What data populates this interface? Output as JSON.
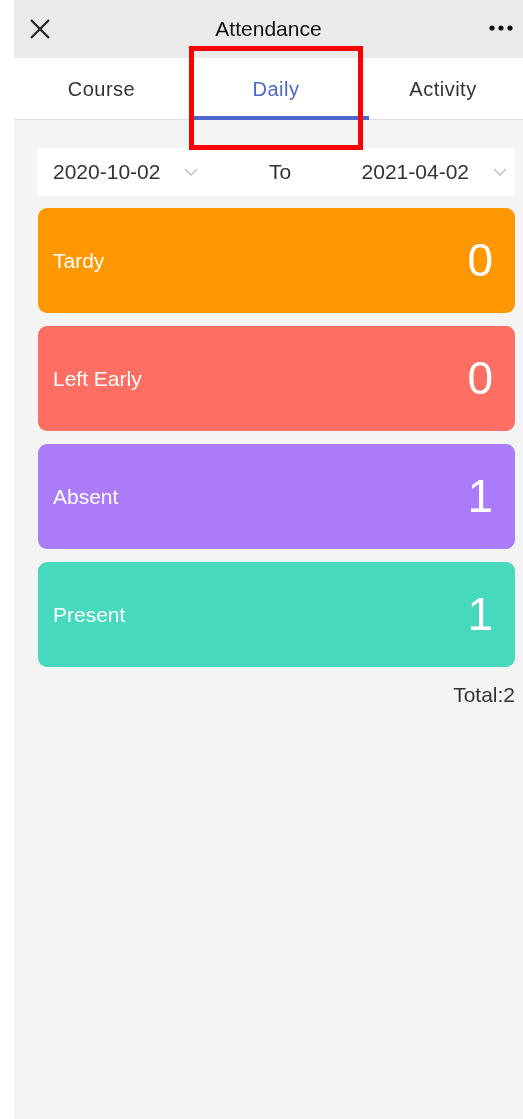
{
  "header": {
    "title": "Attendance"
  },
  "tabs": [
    {
      "label": "Course",
      "selected": false,
      "highlighted": false
    },
    {
      "label": "Daily",
      "selected": true,
      "highlighted": true
    },
    {
      "label": "Activity",
      "selected": false,
      "highlighted": false
    }
  ],
  "date_range": {
    "start": "2020-10-02",
    "separator": "To",
    "end": "2021-04-02"
  },
  "stats": [
    {
      "label": "Tardy",
      "count": "0",
      "color": "#ff9800"
    },
    {
      "label": "Left Early",
      "count": "0",
      "color": "#ff6e62"
    },
    {
      "label": "Absent",
      "count": "1",
      "color": "#aa7bfb"
    },
    {
      "label": "Present",
      "count": "1",
      "color": "#47d9bd"
    }
  ],
  "total": "Total:2"
}
